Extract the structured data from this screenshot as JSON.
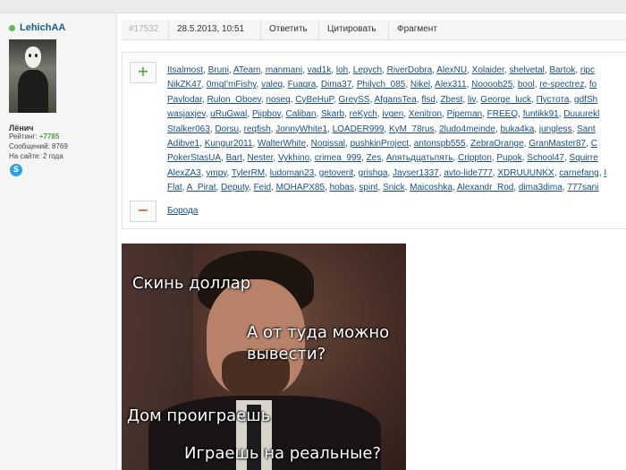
{
  "user": {
    "username": "LehichAA",
    "real_name": "Лёнич",
    "rating_label": "Рейтинг:",
    "rating_value": "+7785",
    "messages_label": "Сообщений:",
    "messages_value": "8769",
    "onsite_label": "На сайте:",
    "onsite_value": "2 года",
    "skype_icon": "skype-icon",
    "online_color": "#5cb85c"
  },
  "post": {
    "number": "#17532",
    "date": "28.5.2013, 10:51",
    "reply_label": "Ответить",
    "quote_label": "Цитировать",
    "fragment_label": "Фрагмент"
  },
  "spoiler": {
    "expand_label": "+",
    "collapse_label": "−",
    "title": "Борода",
    "likes_lines": [
      [
        "Itsalmost",
        "Bruni",
        "ATeam",
        "manmani",
        "vad1k",
        "loh",
        "Lepych",
        "RiverDobra",
        "AlexNU",
        "Xolaider",
        "shelvetal",
        "Bartok",
        "ripc"
      ],
      [
        "NikZK47",
        "0mgI'mFishy",
        "valeq",
        "Fuagra",
        "Dima37",
        "Philych_085",
        "Nikel",
        "Alex311",
        "Noooob25",
        "bool",
        "re-spectrez",
        "fo"
      ],
      [
        "Pavlodar",
        "Rulon_Oboev",
        "noseq",
        "CyBeHuP",
        "GreySS",
        "AfgansTea",
        "flsd",
        "Zbest",
        "liv",
        "George_luck",
        "Пустота",
        "gdfSh"
      ],
      [
        "wasjaxjev",
        "uRuGwal",
        "Piipbov",
        "Caliban",
        "Skarb",
        "reKych",
        "ivgen",
        "Xenitron",
        "Pipeman",
        "FREEQ",
        "funtikk91",
        "Duuurekl"
      ],
      [
        "Stalker063",
        "Dorsu",
        "reqfish",
        "JonnyWhite1",
        "LOADER999",
        "KyM_78rus",
        "2ludo4meinde",
        "buka4ka",
        "jungless",
        "Sant"
      ],
      [
        "Adibve1",
        "Kungur2011",
        "WalterWhite",
        "Noqissal",
        "pushkinProject",
        "antonspb555",
        "ZebraOrange",
        "GranMaster87",
        "C"
      ],
      [
        "PokerStasUA",
        "Bart",
        "Nester",
        "Vykhino",
        "crimea_999",
        "Zes",
        "Апятьдцатьпять",
        "Crippton",
        "Pupok",
        "School47",
        "Squirre"
      ],
      [
        "AlexZA3",
        "ympy",
        "TylerRM",
        "ludoman23",
        "getoverit",
        "grishqa",
        "Jayser1337",
        "avto-lide777",
        "XDRUUUNKX",
        "carnefang",
        "I"
      ],
      [
        "Flat",
        "A_Pirat",
        "Deputy",
        "Feid",
        "MOHAPX85",
        "hobas",
        "spint",
        "Snick",
        "Maicoshka",
        "Alexandr_Rod",
        "dima3dima",
        "777sani"
      ]
    ]
  },
  "meme": {
    "caption_1": "Скинь доллар",
    "caption_2a": "А от туда можно",
    "caption_2b": "вывести?",
    "caption_3": "Дом проиграешь",
    "caption_4": "Играешь на реальные?"
  }
}
